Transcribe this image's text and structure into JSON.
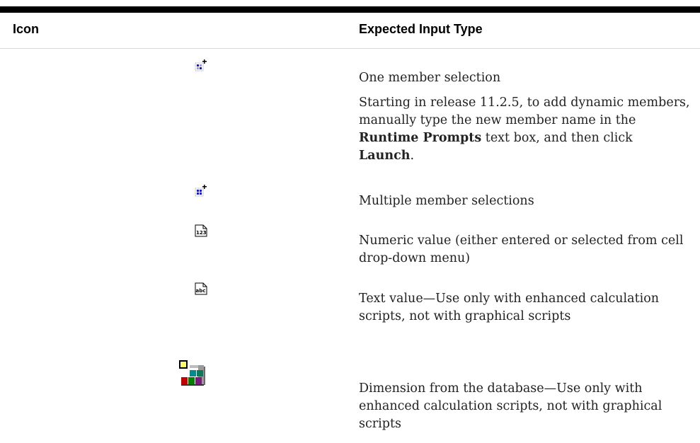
{
  "table": {
    "headers": {
      "icon": "Icon",
      "expected_input_type": "Expected Input Type"
    },
    "rows": [
      {
        "icon": "one-member-selection-icon",
        "text": "One member selection",
        "note": {
          "pre": "Starting in release 11.2.5, to add dynamic members, manually type the new member name in the ",
          "bold1": "Runtime Prompts",
          "mid": " text box, and then click ",
          "bold2": "Launch",
          "post": "."
        }
      },
      {
        "icon": "multiple-member-selection-icon",
        "text": "Multiple member selections"
      },
      {
        "icon": "numeric-value-icon",
        "text": "Numeric value (either entered or selected from cell drop-down menu)"
      },
      {
        "icon": "text-value-icon",
        "text": "Text value—Use only with enhanced calculation scripts, not with graphical scripts"
      },
      {
        "icon": "dimension-icon",
        "text": "Dimension from the database—Use only with enhanced calculation scripts, not with graphical scripts"
      }
    ]
  }
}
